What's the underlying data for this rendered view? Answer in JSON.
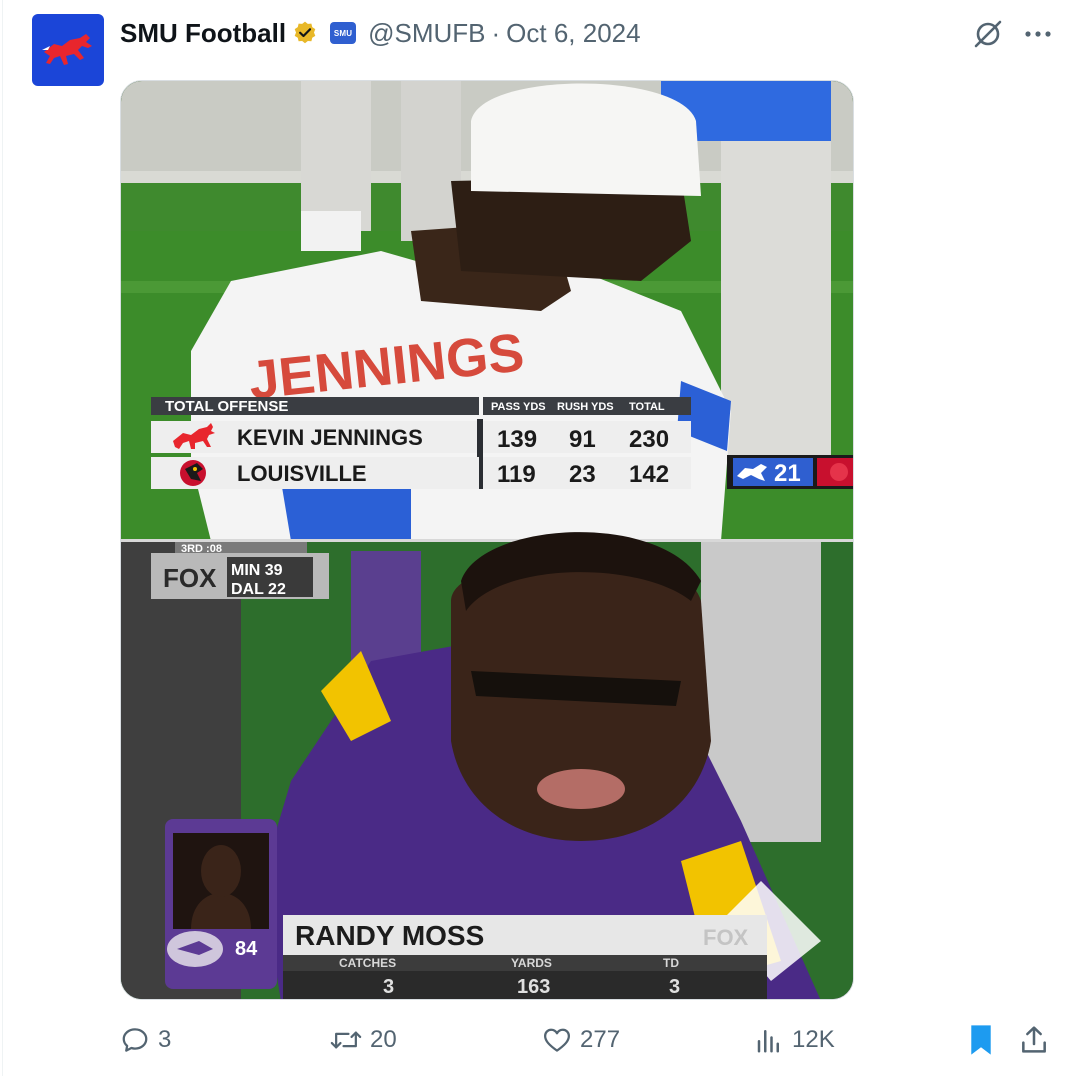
{
  "author": {
    "display_name": "SMU Football",
    "affiliate_badge": "SMU",
    "handle": "@SMUFB",
    "separator": "·",
    "date": "Oct 6, 2024"
  },
  "icons": [
    "avatar-logo",
    "verified-badge-icon",
    "grok-icon",
    "more-icon",
    "reply-icon",
    "retweet-icon",
    "like-icon",
    "views-icon",
    "bookmark-icon",
    "share-icon"
  ],
  "colors": {
    "verified_gold": "#e8b829",
    "bookmark_blue": "#1d9bf0",
    "brand_blue": "#1b45d8",
    "vikings_purple": "#4f2683"
  },
  "media": {
    "top_graphic": {
      "header": "TOTAL OFFENSE",
      "columns": [
        "PASS YDS",
        "RUSH YDS",
        "TOTAL"
      ],
      "rows": [
        {
          "name": "KEVIN JENNINGS",
          "values": [
            "139",
            "91",
            "230"
          ]
        },
        {
          "name": "LOUISVILLE",
          "values": [
            "119",
            "23",
            "142"
          ]
        }
      ],
      "score_bug": "21",
      "jersey_text": "JENNINGS"
    },
    "bottom_graphic": {
      "network": "FOX",
      "score_lines": [
        "MIN 39",
        "DAL 22"
      ],
      "top_partial": "3RD :08",
      "player_number": "84",
      "player_name": "RANDY MOSS",
      "watermark": "FOX",
      "columns": [
        "CATCHES",
        "YARDS",
        "TD"
      ],
      "values": [
        "3",
        "163",
        "3"
      ],
      "jersey_number": "84"
    }
  },
  "stats": {
    "replies": "3",
    "retweets": "20",
    "likes": "277",
    "views": "12K"
  }
}
